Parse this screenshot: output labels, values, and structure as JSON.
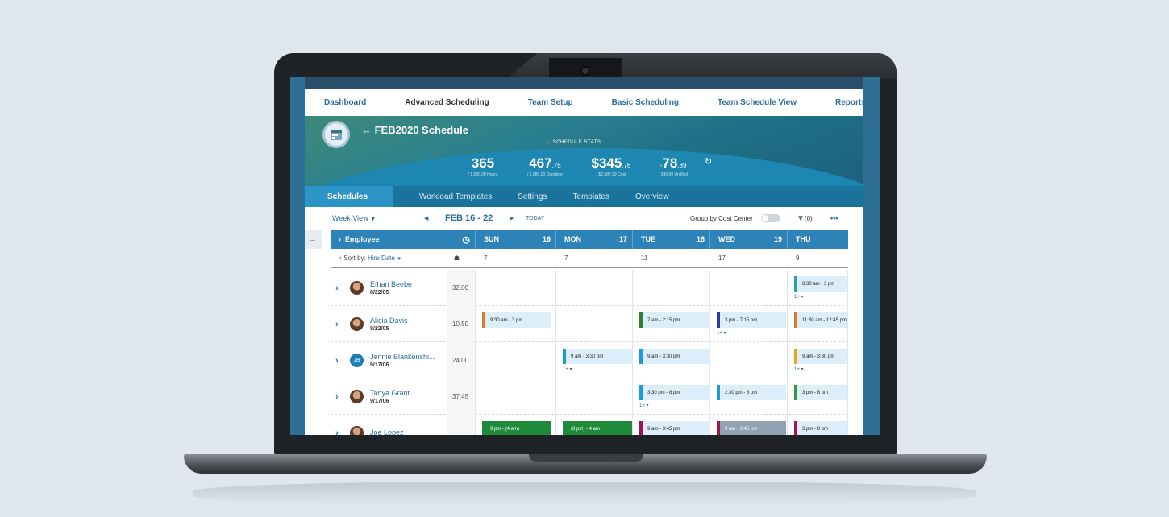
{
  "nav": {
    "items": [
      "Dashboard",
      "Advanced Scheduling",
      "Team Setup",
      "Basic Scheduling",
      "Team Schedule View",
      "Reports"
    ],
    "active_index": 1
  },
  "banner": {
    "title": "FEB2020 Schedule",
    "stats_toggle": "SCHEDULE STATS",
    "stats": [
      {
        "value": "365",
        "suffix": "",
        "sub": "/ 1,680.00 Hours"
      },
      {
        "value": "467",
        "suffix": ".75",
        "sub": "/ 1,680.00 Overtime"
      },
      {
        "value": "$345",
        "suffix": ".76",
        "sub": "/ $2,587.99 Cost"
      },
      {
        "value": "78",
        "suffix": ".89",
        "sub": "/ 346.99 Unfilled"
      }
    ]
  },
  "tabs": [
    "Schedules",
    "Workload Templates",
    "Settings",
    "Templates",
    "Overview"
  ],
  "toolbar": {
    "view": "Week View",
    "date_range": "FEB 16 - 22",
    "today": "TODAY",
    "group_by": "Group by Cost Center",
    "filter_count": "(0)",
    "more": "•••"
  },
  "grid": {
    "employee_header": "Employee",
    "sort_label": "Sort by:",
    "sort_value": "Hire Date",
    "days": [
      {
        "name": "SUN",
        "num": "16",
        "count": "7"
      },
      {
        "name": "MON",
        "num": "17",
        "count": "7"
      },
      {
        "name": "TUE",
        "num": "18",
        "count": "11"
      },
      {
        "name": "WED",
        "num": "19",
        "count": "17"
      },
      {
        "name": "THU",
        "num": "",
        "count": "9"
      }
    ],
    "rows": [
      {
        "name": "Ethan Beebe",
        "date": "8/22/05",
        "hours": "32.00",
        "shifts": [
          null,
          null,
          null,
          null,
          {
            "text": "8:30 am - 3 pm",
            "color": "#2aa3a0",
            "more": "1+ ▾"
          }
        ]
      },
      {
        "name": "Alicia Davis",
        "date": "8/22/05",
        "hours": "10.50",
        "shifts": [
          {
            "text": "9:30 am - 3 pm",
            "color": "#e07b2e"
          },
          null,
          {
            "text": "7 am - 2:15 pm",
            "color": "#2e7d32"
          },
          {
            "text": "3 pm - 7:15 pm",
            "color": "#2b3aa8",
            "more": "1+ ▾"
          },
          {
            "text": "11:30 am - 12:45 pm",
            "color": "#e07b2e"
          }
        ]
      },
      {
        "name": "Jennie Blankenshi...",
        "date": "9/17/06",
        "hours": "24.00",
        "initials": "JB",
        "shifts": [
          null,
          {
            "text": "9 am - 3:30 pm",
            "color": "#1a9bd7",
            "more": "1+ ▾"
          },
          {
            "text": "9 am - 3:30 pm",
            "color": "#1a9bd7"
          },
          null,
          {
            "text": "9 am - 3:30 pm",
            "color": "#e8a41c",
            "more": "1+ ▾"
          }
        ]
      },
      {
        "name": "Tanya Grant",
        "date": "9/17/06",
        "hours": "37.45",
        "shifts": [
          null,
          null,
          {
            "text": "3:30 pm - 8 pm",
            "color": "#1a9bd7",
            "more": "1+ ▾"
          },
          {
            "text": "2:30 pm - 8 pm",
            "color": "#1a9bd7"
          },
          {
            "text": "3 pm - 8 pm",
            "color": "#2e9d3a"
          }
        ]
      },
      {
        "name": "Joe Lopez",
        "date": "",
        "hours": "",
        "shifts": [
          {
            "text": "9 pm - (4 am)",
            "green": true
          },
          {
            "text": "(9 pm) - 4 am",
            "green": true
          },
          {
            "text": "9 am - 3:45 pm",
            "color": "#a3154a"
          },
          {
            "text": "9 am - 3:45 pm",
            "color": "#a3154a",
            "gray": true
          },
          {
            "text": "3 pm - 8 pm",
            "color": "#a3154a"
          }
        ]
      }
    ]
  }
}
